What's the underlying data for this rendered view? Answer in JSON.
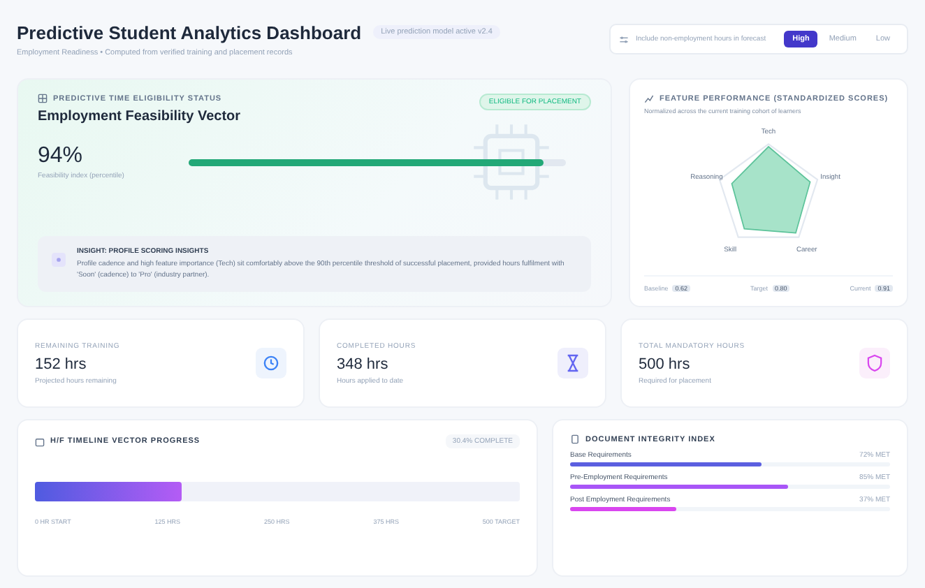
{
  "header": {
    "title": "Predictive Student Analytics Dashboard",
    "badge": "Live prediction model active v2.4",
    "subtitle": "Employment Readiness • Computed from verified training and placement records"
  },
  "filter": {
    "label": "Include non-employment hours in forecast",
    "options": [
      {
        "label": "High",
        "selected": true
      },
      {
        "label": "Medium",
        "selected": false
      },
      {
        "label": "Low",
        "selected": false
      }
    ]
  },
  "feasibility": {
    "eyebrow": "PREDICTIVE TIME ELIGIBILITY STATUS",
    "title": "Employment Feasibility Vector",
    "badge": "ELIGIBLE FOR PLACEMENT",
    "value": "94%",
    "caption": "Feasibility index (percentile)",
    "level": 0.94,
    "insight": {
      "title": "INSIGHT: PROFILE SCORING INSIGHTS",
      "text": "Profile cadence and high feature importance (Tech) sit comfortably above the 90th percentile threshold of successful placement, provided hours fulfilment with 'Soon' (cadence) to 'Pro' (industry partner)."
    }
  },
  "radar": {
    "title": "FEATURE PERFORMANCE (STANDARDIZED SCORES)",
    "caption": "Normalized across the current training cohort of learners",
    "axes": [
      "Tech",
      "Reasoning",
      "Insight",
      "Skill",
      "Career"
    ],
    "legend": [
      {
        "label": "Baseline",
        "value": "0.62"
      },
      {
        "label": "Target",
        "value": "0.80"
      },
      {
        "label": "Current",
        "value": "0.91"
      }
    ]
  },
  "stats": [
    {
      "label": "REMAINING TRAINING",
      "value": "152 hrs",
      "caption": "Projected hours remaining",
      "kind": "clock"
    },
    {
      "label": "COMPLETED HOURS",
      "value": "348 hrs",
      "caption": "Hours applied to date",
      "kind": "hourglass"
    },
    {
      "label": "TOTAL MANDATORY HOURS",
      "value": "500 hrs",
      "caption": "Required for placement",
      "kind": "shield"
    }
  ],
  "timeline": {
    "title": "H/F TIMELINE VECTOR PROGRESS",
    "badge": "30.4% COMPLETE",
    "level": 0.304,
    "ticks": [
      "0 HR START",
      "125 HRS",
      "250 HRS",
      "375 HRS",
      "500 TARGET"
    ]
  },
  "integrity": {
    "title": "DOCUMENT INTEGRITY INDEX",
    "rows": [
      {
        "label": "Base Requirements",
        "value": "72% MET",
        "level": 0.6,
        "color": "#5b5fe0"
      },
      {
        "label": "Pre-Employment Requirements",
        "value": "85% MET",
        "level": 0.68,
        "color": "#a855f7"
      },
      {
        "label": "Post Employment Requirements",
        "value": "37% MET",
        "level": 0.33,
        "color": "#d946ef"
      }
    ]
  }
}
